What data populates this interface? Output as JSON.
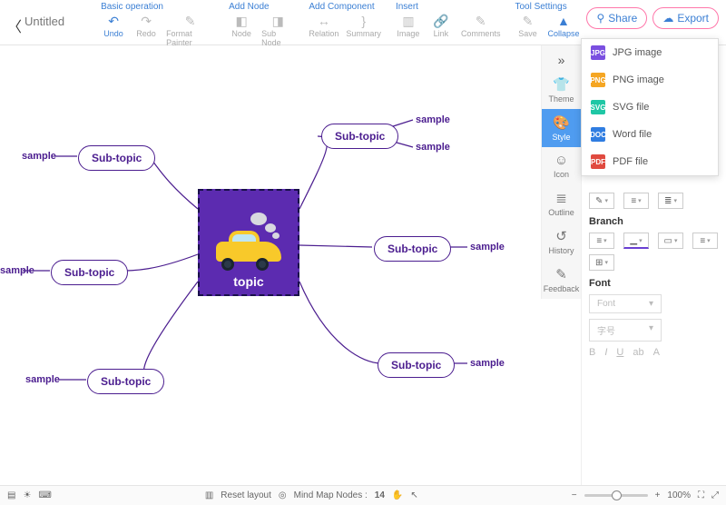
{
  "title": "Untitled",
  "toolbar": {
    "groups": [
      {
        "label": "Basic operation",
        "items": [
          {
            "id": "undo",
            "label": "Undo",
            "icon": "↶",
            "active": true
          },
          {
            "id": "redo",
            "label": "Redo",
            "icon": "↷"
          },
          {
            "id": "fmtpaint",
            "label": "Format Painter",
            "icon": "✎"
          }
        ]
      },
      {
        "label": "Add Node",
        "items": [
          {
            "id": "node",
            "label": "Node",
            "icon": "◧"
          },
          {
            "id": "subnode",
            "label": "Sub Node",
            "icon": "◨"
          }
        ]
      },
      {
        "label": "Add Component",
        "items": [
          {
            "id": "relation",
            "label": "Relation",
            "icon": "↔"
          },
          {
            "id": "summary",
            "label": "Summary",
            "icon": "}"
          }
        ]
      },
      {
        "label": "Insert",
        "items": [
          {
            "id": "image",
            "label": "Image",
            "icon": "▥"
          },
          {
            "id": "link",
            "label": "Link",
            "icon": "🔗"
          },
          {
            "id": "comments",
            "label": "Comments",
            "icon": "✎"
          }
        ]
      },
      {
        "label": "Tool Settings",
        "items": [
          {
            "id": "save",
            "label": "Save",
            "icon": "✎"
          },
          {
            "id": "collapse",
            "label": "Collapse",
            "icon": "▲",
            "active": true
          }
        ]
      }
    ],
    "share": "Share",
    "export": "Export"
  },
  "export_menu": [
    {
      "label": "JPG image",
      "color": "#7a4fe0",
      "tag": "JPG"
    },
    {
      "label": "PNG image",
      "color": "#f5a623",
      "tag": "PNG"
    },
    {
      "label": "SVG file",
      "color": "#1fc7a5",
      "tag": "SVG"
    },
    {
      "label": "Word file",
      "color": "#2f7de1",
      "tag": "DOC"
    },
    {
      "label": "PDF file",
      "color": "#e04a3f",
      "tag": "PDF"
    }
  ],
  "sidetabs": [
    {
      "id": "theme",
      "label": "Theme",
      "icon": "👕"
    },
    {
      "id": "style",
      "label": "Style",
      "icon": "🎨",
      "selected": true
    },
    {
      "id": "icon",
      "label": "Icon",
      "icon": "☺"
    },
    {
      "id": "outline",
      "label": "Outline",
      "icon": "≣"
    },
    {
      "id": "history",
      "label": "History",
      "icon": "↺"
    },
    {
      "id": "feedback",
      "label": "Feedback",
      "icon": "✎"
    }
  ],
  "stylepanel": {
    "section_branch": "Branch",
    "section_font": "Font",
    "font_placeholder": "Font",
    "size_placeholder": "字号",
    "formats": [
      "B",
      "I",
      "U",
      "ab",
      "A"
    ]
  },
  "mindmap": {
    "center": "topic",
    "subs": [
      "Sub-topic",
      "Sub-topic",
      "Sub-topic",
      "Sub-topic",
      "Sub-topic",
      "Sub-topic"
    ],
    "samples": [
      "sample",
      "sample",
      "sample",
      "sample",
      "sample",
      "sample",
      "sample"
    ]
  },
  "statusbar": {
    "reset": "Reset layout",
    "nodes_label": "Mind Map Nodes :",
    "nodes_count": "14",
    "zoom": "100%"
  }
}
